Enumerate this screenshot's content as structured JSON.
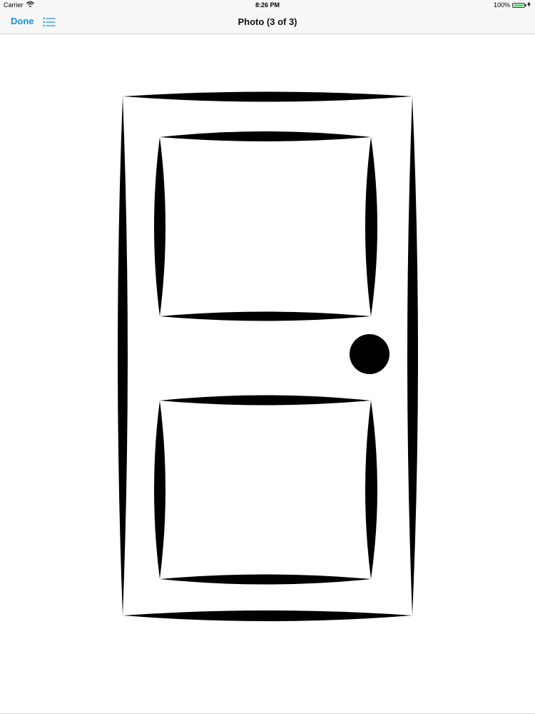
{
  "status_bar": {
    "carrier": "Carrier",
    "time": "8:26 PM",
    "battery_percent": "100%",
    "battery_level": 1.0
  },
  "nav_bar": {
    "done_label": "Done",
    "title": "Photo (3 of 3)",
    "list_icon": "list-icon"
  },
  "photo": {
    "subject_icon": "door-icon"
  },
  "colors": {
    "accent": "#1a8fe3",
    "bar_background": "#f7f7f8",
    "battery_green": "#4cd964"
  }
}
